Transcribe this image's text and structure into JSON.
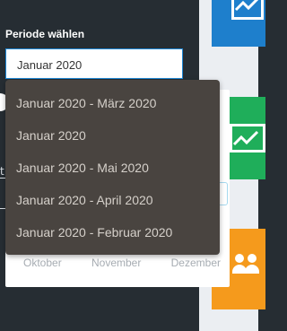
{
  "form": {
    "label": "Periode wählen",
    "selected_value": "Januar 2020"
  },
  "dropdown": {
    "options": [
      "Januar 2020 - März 2020",
      "Januar 2020",
      "Januar 2020 - Mai 2020",
      "Januar 2020 - April 2020",
      "Januar 2020 - Februar 2020"
    ]
  },
  "calendar": {
    "months": [
      "Oktober",
      "November",
      "Dezember"
    ]
  },
  "colors": {
    "panel_bg": "#262d33",
    "dropdown_bg": "#494440",
    "tile_blue": "#1e7fcc",
    "tile_green": "#1fae5a",
    "tile_orange": "#f59a1c"
  },
  "icons": {
    "tile_blue_icon": "chart-icon",
    "tile_green_icon": "line-chart-icon",
    "tile_orange_icon": "users-icon"
  }
}
